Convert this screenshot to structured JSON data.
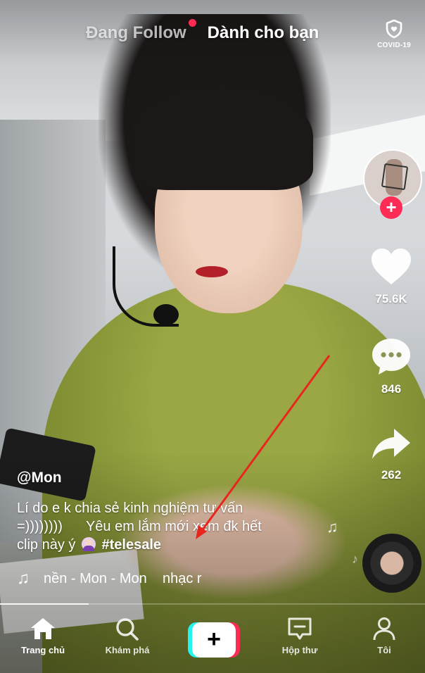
{
  "top_tabs": {
    "following": "Đang Follow",
    "for_you": "Dành cho bạn",
    "covid_label": "COVID-19"
  },
  "right_rail": {
    "likes": "75.6K",
    "comments": "846",
    "shares": "262"
  },
  "post": {
    "username": "@Mon",
    "caption_line1": "Lí do e k chia sẻ kinh nghiệm tư vấn",
    "caption_line2": "=))))))))      Yêu em lắm mới xem đk hết",
    "caption_line3_text": "clip này ý",
    "hashtag": "#telesale",
    "music": "nền - Mon - Mon    nhạc r"
  },
  "bottom_nav": {
    "home": "Trang chủ",
    "discover": "Khám phá",
    "create": "+",
    "inbox": "Hộp thư",
    "profile": "Tôi"
  },
  "colors": {
    "accent_red": "#fe2c55",
    "accent_cyan": "#25f4ee",
    "annotation_arrow": "#e8261e"
  }
}
